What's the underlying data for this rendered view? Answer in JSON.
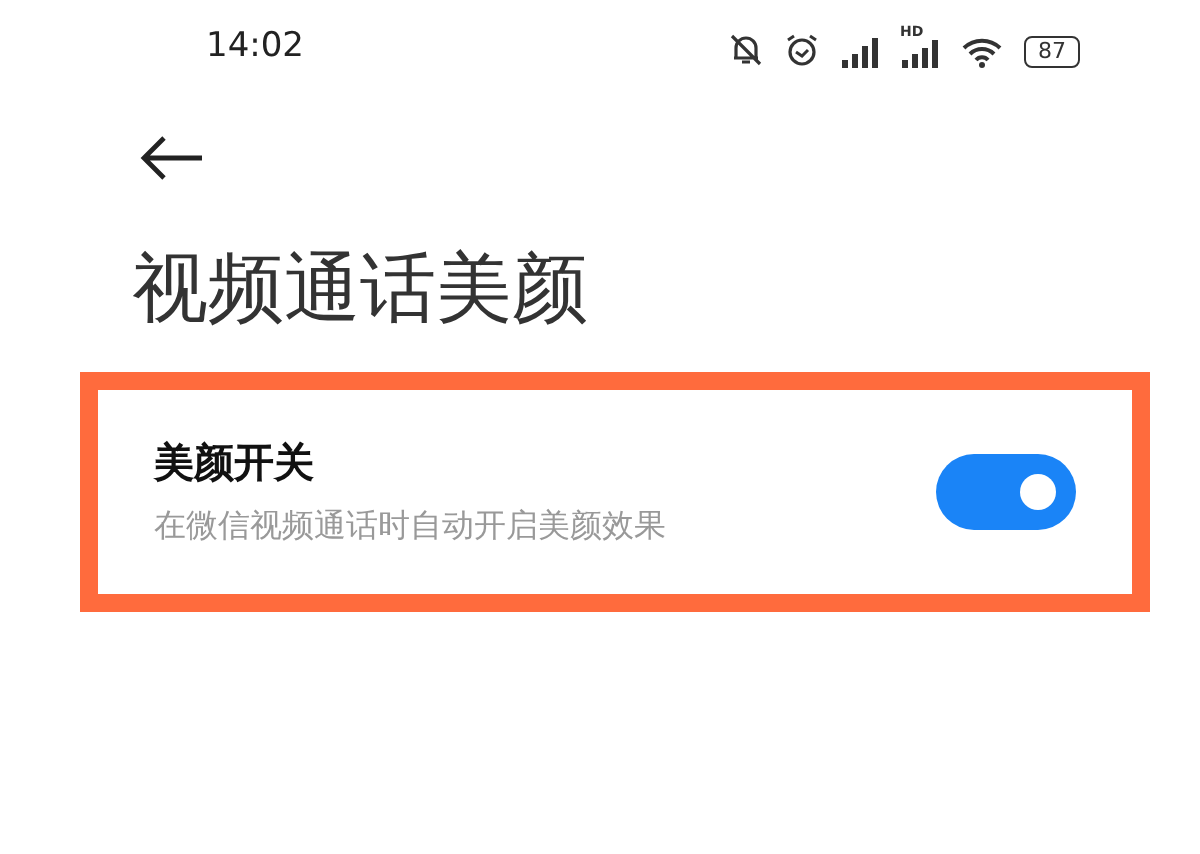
{
  "status_bar": {
    "time": "14:02",
    "network_label": "HD",
    "battery": "87"
  },
  "title": "视频通话美颜",
  "setting": {
    "label": "美颜开关",
    "description": "在微信视频通话时自动开启美颜效果",
    "on": true,
    "highlighted": true
  }
}
